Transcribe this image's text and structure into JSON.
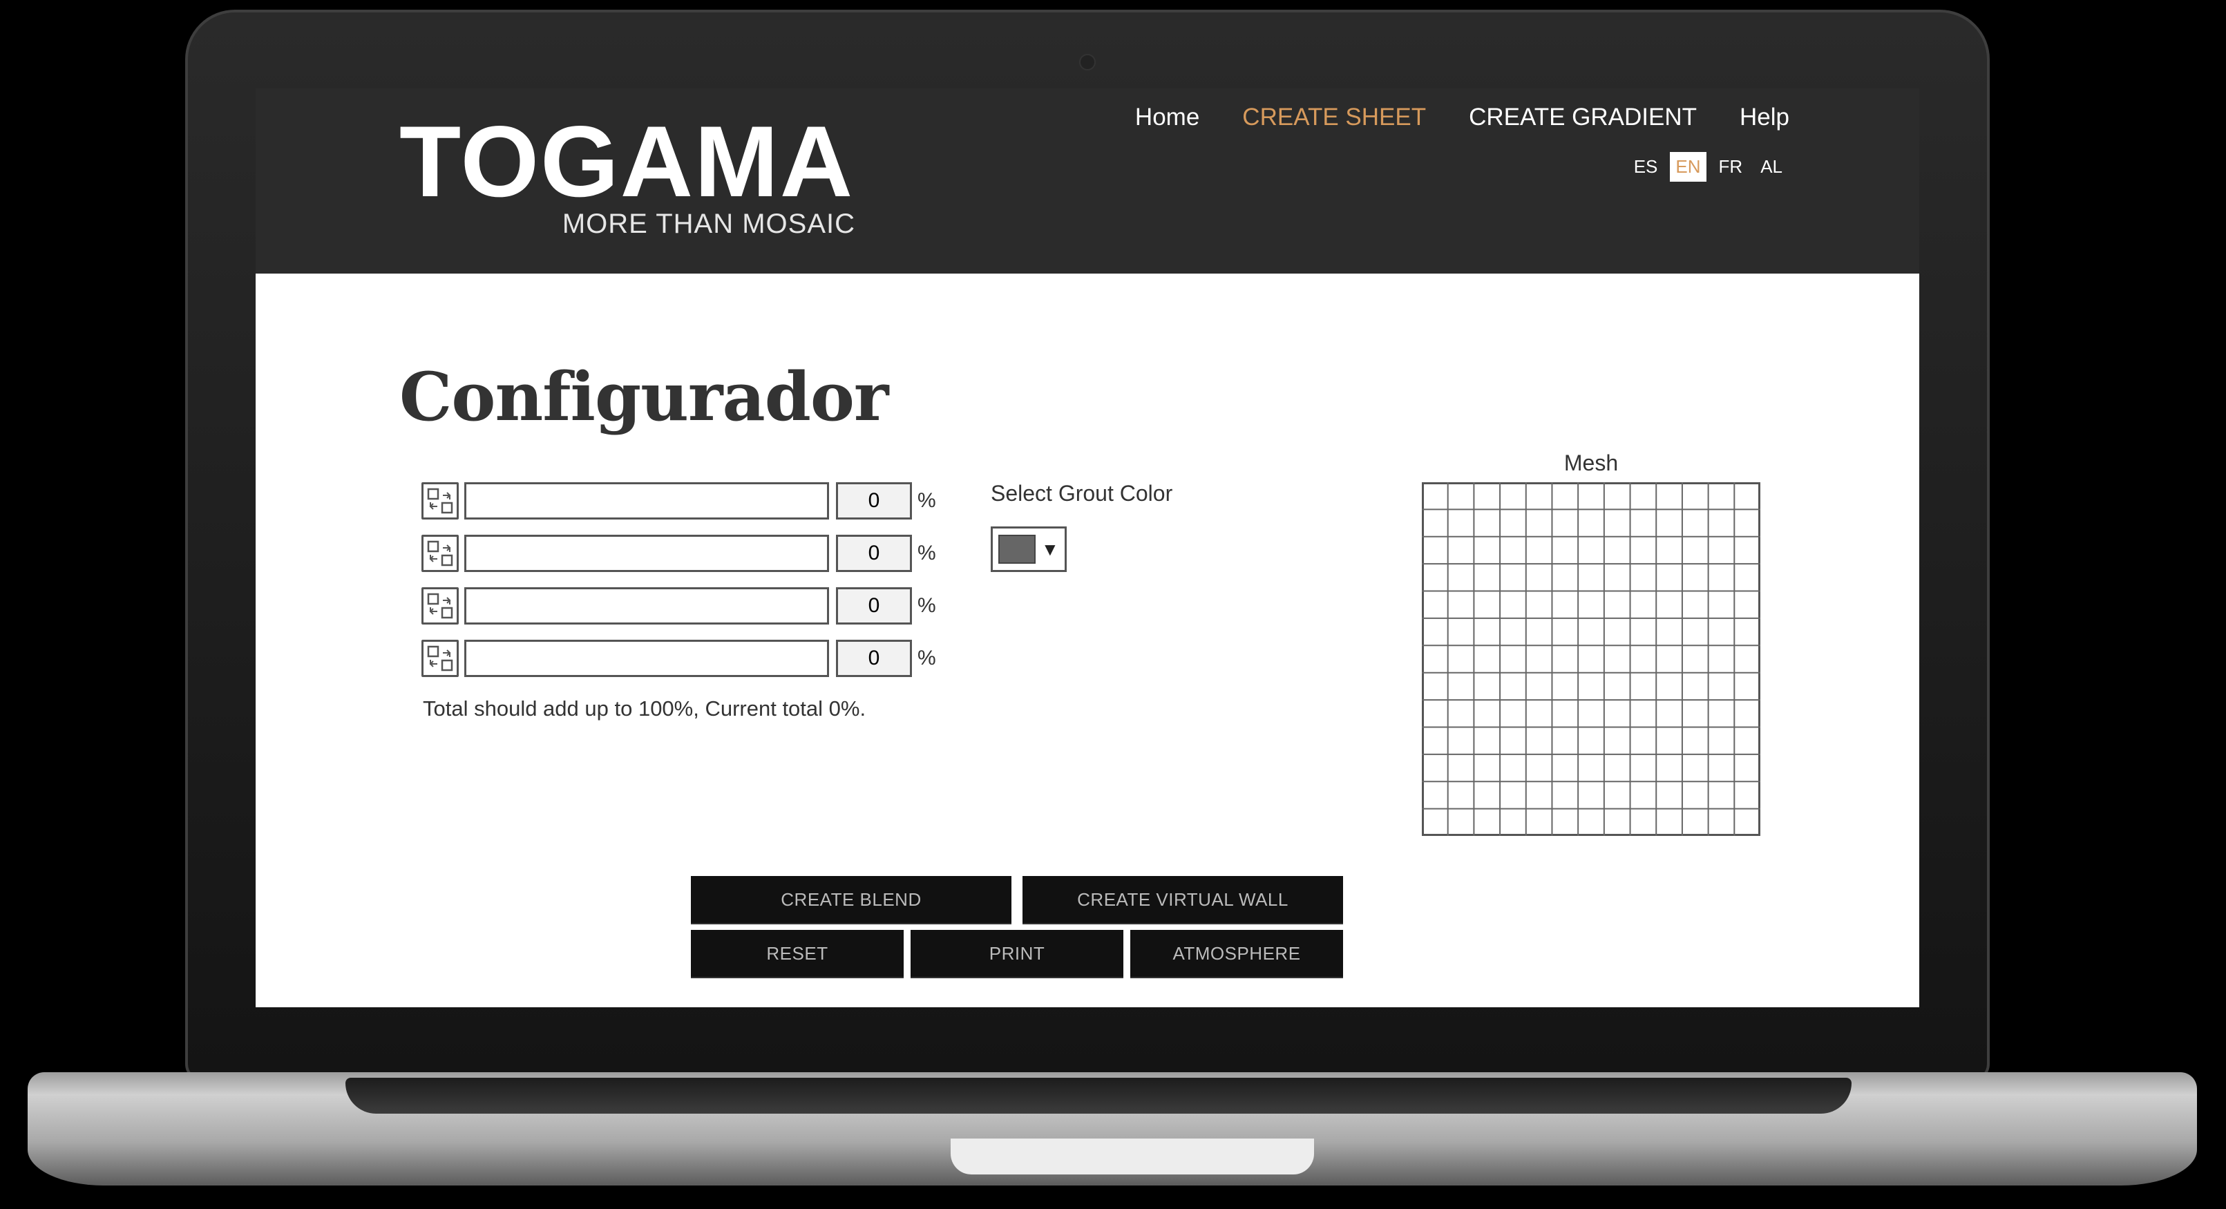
{
  "brand": {
    "name": "TOGAMA",
    "tagline": "MORE THAN MOSAIC"
  },
  "nav": {
    "items": [
      {
        "label": "Home"
      },
      {
        "label": "CREATE SHEET"
      },
      {
        "label": "CREATE GRADIENT"
      },
      {
        "label": "Help"
      }
    ],
    "active_item": "CREATE SHEET"
  },
  "languages": {
    "items": [
      "ES",
      "EN",
      "FR",
      "AL"
    ],
    "active": "EN"
  },
  "page": {
    "title": "Configurador"
  },
  "blend": {
    "rows": [
      {
        "tile": "",
        "percent": "0"
      },
      {
        "tile": "",
        "percent": "0"
      },
      {
        "tile": "",
        "percent": "0"
      },
      {
        "tile": "",
        "percent": "0"
      }
    ],
    "percent_sign": "%",
    "total_message": "Total should add up to 100%, Current total 0%."
  },
  "grout": {
    "label": "Select Grout Color",
    "selected_color": "#666666",
    "arrow": "▼"
  },
  "mesh": {
    "label": "Mesh",
    "columns": 13,
    "rows": 13
  },
  "actions": {
    "create_blend": "CREATE BLEND",
    "create_virtual_wall": "CREATE VIRTUAL WALL",
    "reset": "RESET",
    "print": "PRINT",
    "atmosphere": "ATMOSPHERE"
  },
  "colors": {
    "header_bg": "#2b2b2b",
    "accent": "#d79a5c",
    "button_bg": "#111111"
  }
}
